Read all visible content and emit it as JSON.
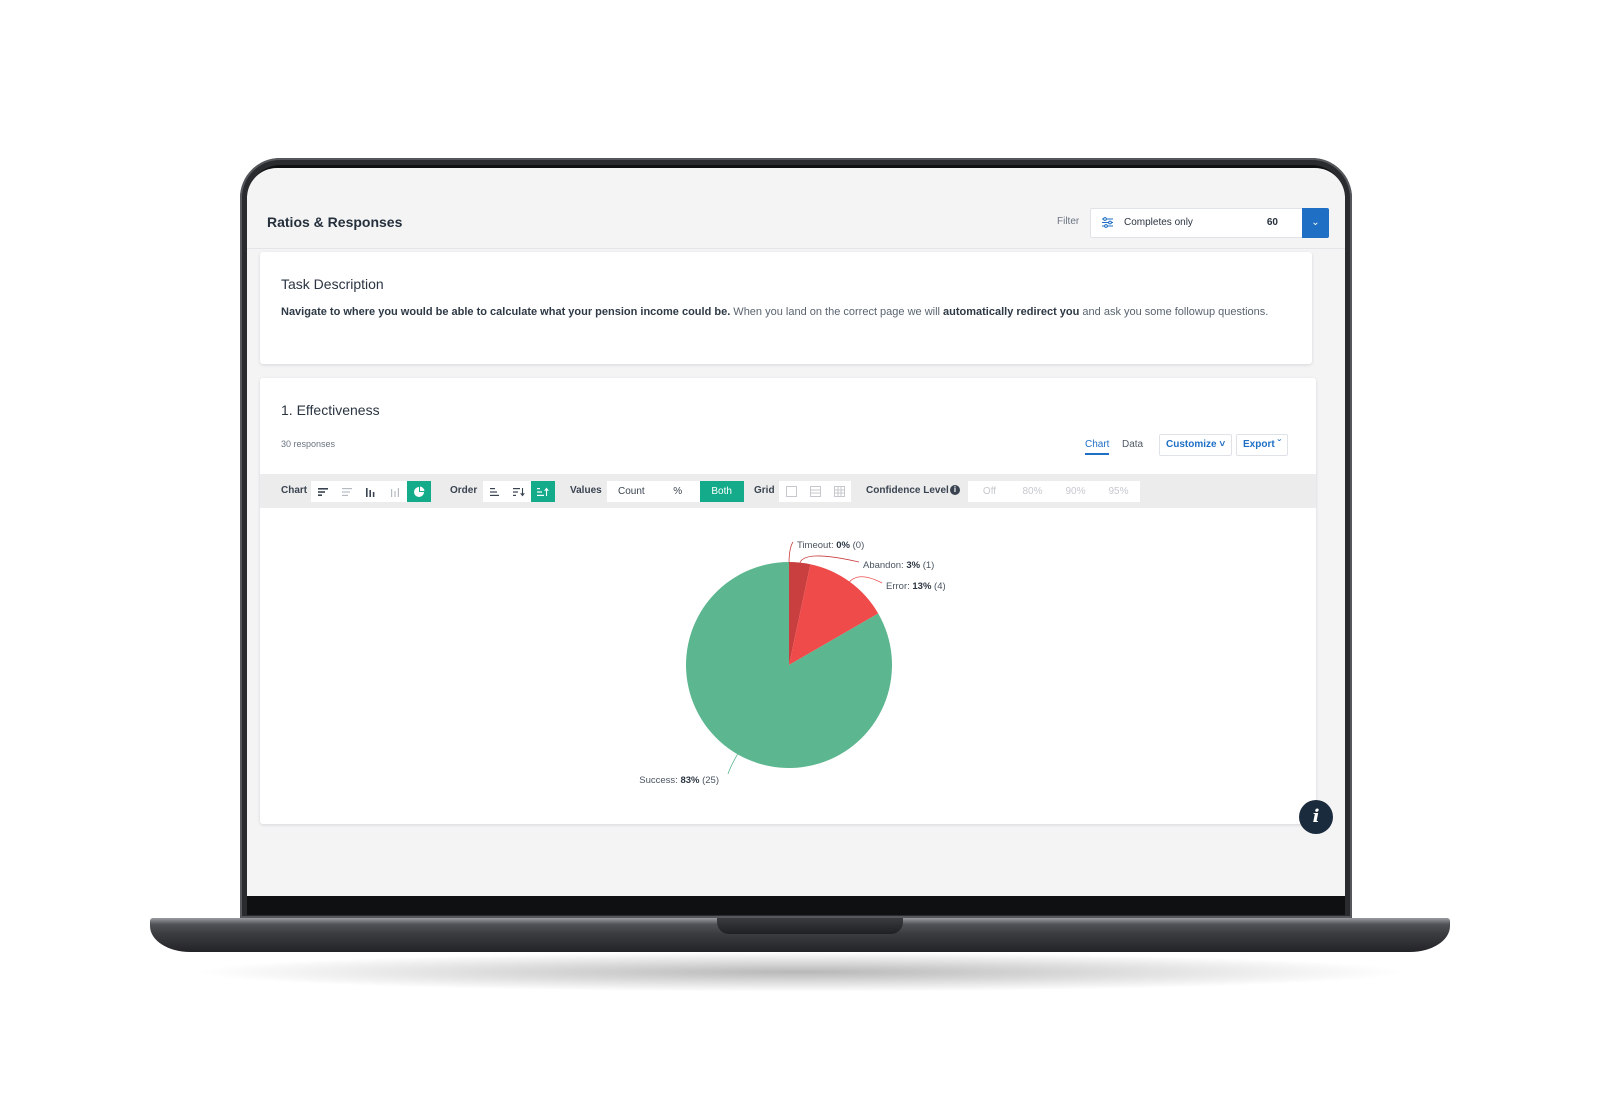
{
  "header": {
    "title": "Ratios & Responses",
    "filter_label": "Filter",
    "filter_value": "Completes only",
    "filter_count": "60"
  },
  "task": {
    "heading": "Task Description",
    "text_bold_1": "Navigate to where you would be able to calculate what your pension income could be.",
    "text_plain_1": " When you land on the correct page we will ",
    "text_bold_2": "automatically redirect you",
    "text_plain_2": " and ask you some followup questions."
  },
  "effectiveness": {
    "heading": "1. Effectiveness",
    "responses": "30 responses",
    "tabs": {
      "chart": "Chart",
      "data": "Data"
    },
    "customize": "Customize",
    "export": "Export"
  },
  "toolbar": {
    "chart_label": "Chart",
    "order_label": "Order",
    "values_label": "Values",
    "values_options": [
      "Count",
      "%",
      "Both"
    ],
    "values_selected": "Both",
    "grid_label": "Grid",
    "confidence_label": "Confidence Level",
    "confidence_options": [
      "Off",
      "80%",
      "90%",
      "95%"
    ]
  },
  "colors": {
    "accent": "#13ab8a",
    "brand_blue": "#1f6fc5",
    "success": "#5cb68f",
    "error": "#ef4b4b",
    "abandon": "#c93f3f"
  },
  "chart_data": {
    "type": "pie",
    "slices": [
      {
        "name": "Timeout",
        "percent": "0%",
        "count": "(0)",
        "value": 0,
        "color": "#c93f3f"
      },
      {
        "name": "Abandon",
        "percent": "3%",
        "count": "(1)",
        "value": 1,
        "color": "#c93f3f"
      },
      {
        "name": "Error",
        "percent": "13%",
        "count": "(4)",
        "value": 4,
        "color": "#ef4b4b"
      },
      {
        "name": "Success",
        "percent": "83%",
        "count": "(25)",
        "value": 25,
        "color": "#5cb68f"
      }
    ]
  }
}
